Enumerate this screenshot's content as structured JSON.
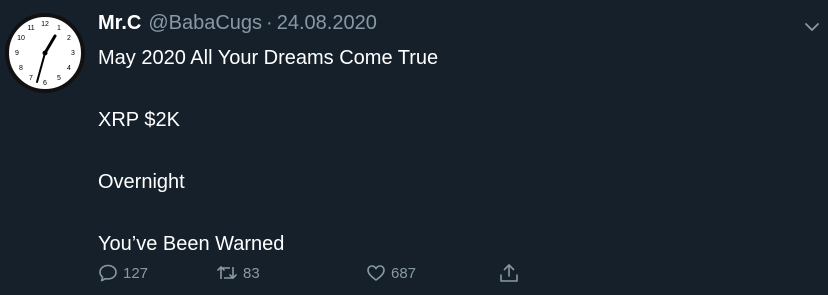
{
  "tweet": {
    "author_name": "Mr.C",
    "handle": "@BabaCugs",
    "separator": "·",
    "date": "24.08.2020",
    "lines": [
      "May 2020 All Your Dreams Come True",
      "XRP $2K",
      "Overnight",
      "You’ve Been Warned"
    ],
    "reply_count": "127",
    "retweet_count": "83",
    "like_count": "687"
  },
  "avatar": {
    "clock_numbers": [
      "12",
      "1",
      "2",
      "3",
      "4",
      "5",
      "6",
      "7",
      "8",
      "9",
      "10",
      "11"
    ]
  },
  "icons": {
    "avatar": "wall-clock-icon",
    "menu": "chevron-down-icon",
    "reply": "speech-bubble-icon",
    "retweet": "retweet-arrows-icon",
    "like": "heart-icon",
    "share": "share-upload-icon"
  },
  "colors": {
    "background": "#15202b",
    "primary_text": "#ffffff",
    "secondary_text": "#8899a6"
  }
}
